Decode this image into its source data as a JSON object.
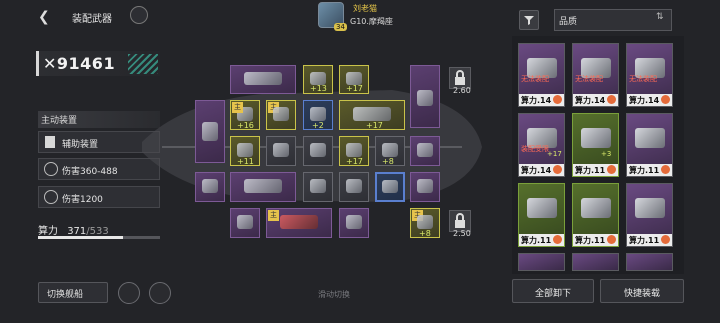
{
  "header": {
    "title": "装配武器",
    "commander_name": "刘老猫",
    "commander_level": "34",
    "commander_rank": "G10.摩羯座"
  },
  "power": {
    "value": "91461"
  },
  "left_panel": {
    "section_label": "主动装置",
    "aux_device": "辅助装置",
    "damage_1": "伤害360-488",
    "damage_2": "伤害1200",
    "capacity_label": "算力",
    "capacity_value": "371",
    "capacity_max": "/533",
    "capacity_fraction": 0.696
  },
  "grid": {
    "badge_13": "+13",
    "badge_17a": "+17",
    "badge_16": "+16",
    "badge_11": "+11",
    "badge_2": "+2",
    "badge_17b": "+17",
    "badge_17c": "+17",
    "badge_8a": "+8",
    "badge_8b": "+8",
    "main_tag": "主",
    "lock_1": "2.60",
    "lock_2": "2.50"
  },
  "inventory": {
    "sort_label": "品质",
    "cards": [
      {
        "warn": "无法装配",
        "power": "算力.14"
      },
      {
        "warn": "无法装配",
        "power": "算力.14"
      },
      {
        "warn": "无法装配",
        "power": "算力.14"
      },
      {
        "warn": "装配受限",
        "power": "算力.14",
        "plus": "+17"
      },
      {
        "power": "算力.11",
        "plus": "+3"
      },
      {
        "power": "算力.11"
      },
      {
        "power": "算力.11"
      },
      {
        "power": "算力.11"
      },
      {
        "power": "算力.11"
      }
    ]
  },
  "footer": {
    "switch_ship": "切换舰船",
    "slide_hint": "滑动切换",
    "unequip_all": "全部卸下",
    "quick_equip": "快捷装载"
  },
  "colors": {
    "accent_yellow": "#e6c34c",
    "rare_purple": "#6a4a82",
    "warning_red": "#ff6a55"
  }
}
